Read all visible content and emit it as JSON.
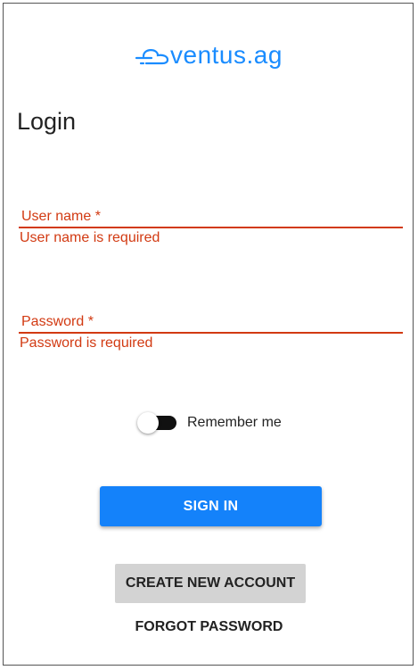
{
  "logo": {
    "text": "ventus.ag",
    "icon": "wind-cloud-icon",
    "color": "#1a8cff"
  },
  "page": {
    "title": "Login"
  },
  "form": {
    "username": {
      "label": "User name *",
      "value": "",
      "error": "User name is required"
    },
    "password": {
      "label": "Password *",
      "value": "",
      "error": "Password is required"
    },
    "remember": {
      "label": "Remember me",
      "checked": false
    }
  },
  "actions": {
    "signin_label": "SIGN IN",
    "create_label": "CREATE NEW ACCOUNT",
    "forgot_label": "FORGOT PASSWORD"
  },
  "colors": {
    "accent": "#1482fa",
    "error": "#d23a12",
    "secondary_button": "#d3d3d3",
    "toggle_track": "#111111"
  }
}
